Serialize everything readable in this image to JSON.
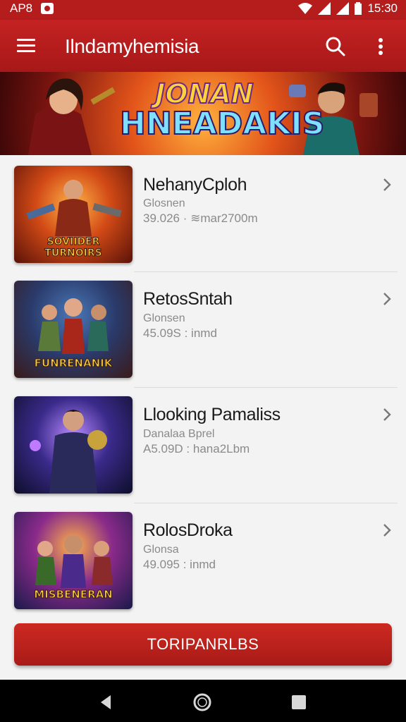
{
  "status_bar": {
    "carrier": "AP8",
    "time": "15:30"
  },
  "app_bar": {
    "title": "Ilndamyhemisia"
  },
  "banner": {
    "line1": "JONAN",
    "line2": "HNEADAKIS"
  },
  "items": [
    {
      "title": "NehanyCploh",
      "subtitle": "Glosnen",
      "meta": "39.026 · ≋mar2700m",
      "art": "SOVIIDER TURNOIRS"
    },
    {
      "title": "RetosSntah",
      "subtitle": "Glonsen",
      "meta": "45.09S : inmd",
      "art": "FUNRENANIK"
    },
    {
      "title": "Llooking Pamaliss",
      "subtitle": "Danalaa Bprel",
      "meta": "A5.09D : hana2Lbm",
      "art": ""
    },
    {
      "title": "RolosDroka",
      "subtitle": "Glonsa",
      "meta": "49.095 : inmd",
      "art": "MISBENERAN"
    }
  ],
  "cta": {
    "label": "TORIPANRLBS"
  },
  "colors": {
    "brand_red": "#b51d1d",
    "background": "#f3f3f3"
  }
}
